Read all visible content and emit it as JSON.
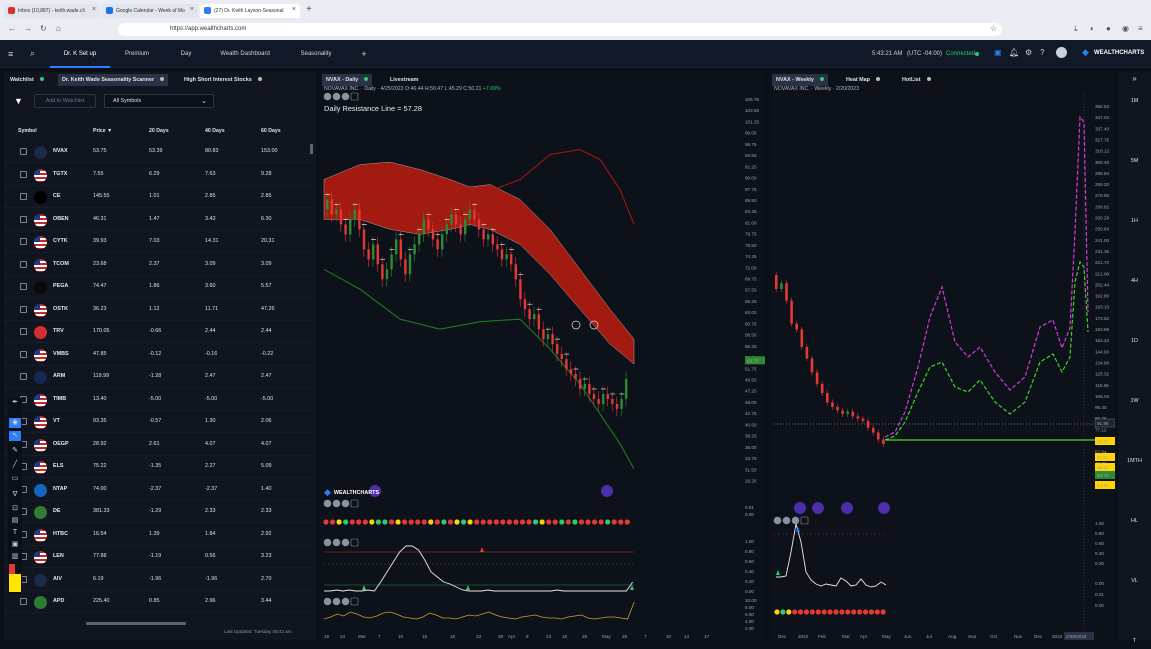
{
  "browser": {
    "tabs": [
      "Inbox (10,887) - keith.wade.cli",
      "Google Calendar - Week of Mo",
      "(27) Dr. Keith Layson-Seasonal"
    ],
    "url": "https://app.wealthcharts.com"
  },
  "app": {
    "tabs": [
      "Dr. K Set up",
      "Premium",
      "Day",
      "Wealth Dashboard",
      "Seasonality",
      "+"
    ],
    "time": "5:43:21 AM",
    "timezone": "(UTC -04:00)",
    "connection": "Connected",
    "brand": "WEALTHCHARTS"
  },
  "left": {
    "tabs": [
      "Watchlist",
      "Dr. Keith Wade Seasonality Scanner",
      "High Short Interest Stocks"
    ],
    "add_button": "Add to Watchlist",
    "filter_select": "All Symbols",
    "columns": [
      "Symbol",
      "Price",
      "20 Days",
      "40 Days",
      "60 Days"
    ],
    "rows": [
      {
        "sym": "NVAX",
        "price": "53.75",
        "d20": "53.39",
        "d40": "80.83",
        "d60": "153.00"
      },
      {
        "sym": "TGTX",
        "price": "7.55",
        "d20": "6.29",
        "d40": "7.63",
        "d60": "9.28"
      },
      {
        "sym": "CE",
        "price": "145.55",
        "d20": "1.01",
        "d40": "2.85",
        "d60": "2.85"
      },
      {
        "sym": "OBEN",
        "price": "46.31",
        "d20": "1.47",
        "d40": "3.43",
        "d60": "6.30"
      },
      {
        "sym": "CYTK",
        "price": "39.93",
        "d20": "7.03",
        "d40": "14.31",
        "d60": "20.31"
      },
      {
        "sym": "TCOM",
        "price": "23.68",
        "d20": "2.37",
        "d40": "3.09",
        "d60": "3.09"
      },
      {
        "sym": "PEGA",
        "price": "74.47",
        "d20": "1.86",
        "d40": "3.60",
        "d60": "5.57"
      },
      {
        "sym": "OSTK",
        "price": "36.23",
        "d20": "1.12",
        "d40": "11.71",
        "d60": "47.26"
      },
      {
        "sym": "TRV",
        "price": "170.05",
        "d20": "-0.66",
        "d40": "2.44",
        "d60": "2.44"
      },
      {
        "sym": "VMBS",
        "price": "47.85",
        "d20": "-0.12",
        "d40": "-0.16",
        "d60": "-0.22"
      },
      {
        "sym": "ARM",
        "price": "119.99",
        "d20": "-1.28",
        "d40": "2.47",
        "d60": "2.47"
      },
      {
        "sym": "TIMB",
        "price": "13.40",
        "d20": "-5.00",
        "d40": "-5.00",
        "d60": "-5.00"
      },
      {
        "sym": "VT",
        "price": "93.35",
        "d20": "-0.57",
        "d40": "1.30",
        "d60": "2.06"
      },
      {
        "sym": "OEGP",
        "price": "28.92",
        "d20": "2.61",
        "d40": "4.07",
        "d60": "4.07"
      },
      {
        "sym": "ELS",
        "price": "75.22",
        "d20": "-1.35",
        "d40": "2.27",
        "d60": "5.09"
      },
      {
        "sym": "NTAP",
        "price": "74.00",
        "d20": "-2.37",
        "d40": "-2.37",
        "d60": "1.40"
      },
      {
        "sym": "DE",
        "price": "381.33",
        "d20": "-1.29",
        "d40": "2.33",
        "d60": "2.33"
      },
      {
        "sym": "HTBC",
        "price": "16.54",
        "d20": "1.39",
        "d40": "1.84",
        "d60": "2.92"
      },
      {
        "sym": "LEN",
        "price": "77.88",
        "d20": "-1.19",
        "d40": "0.56",
        "d60": "3.23"
      },
      {
        "sym": "AIV",
        "price": "6.19",
        "d20": "-1.96",
        "d40": "-1.96",
        "d60": "2.70"
      },
      {
        "sym": "APD",
        "price": "225.40",
        "d20": "0.85",
        "d40": "2.96",
        "d60": "3.44"
      }
    ],
    "last_updated": "Last Updated: Tuesday 05:42 am"
  },
  "mid": {
    "tabs": [
      "NVAX - Daily",
      "Livestream"
    ],
    "symbol_line": "NOVAVAX INC. · Daily · 4/25/2022 O:46.44 H:50.47 L:45.29 C:50.21",
    "change": "+7.69%",
    "resistance": "Daily Resistance Line = 57.28",
    "brand": "WEALTHCHARTS",
    "price_axis": [
      "105.75",
      "103.50",
      "101.25",
      "99.00",
      "96.75",
      "94.50",
      "92.25",
      "90.00",
      "87.75",
      "85.50",
      "83.25",
      "81.00",
      "78.75",
      "76.50",
      "74.25",
      "72.00",
      "69.75",
      "67.50",
      "65.25",
      "63.00",
      "60.75",
      "58.50",
      "56.25",
      "54.00",
      "51.75",
      "49.50",
      "47.25",
      "45.00",
      "42.75",
      "40.50",
      "38.25",
      "36.00",
      "33.75",
      "31.50",
      "29.25"
    ],
    "last_price": "53.75",
    "date_axis": [
      "19",
      "24",
      "Mar",
      "7",
      "10",
      "15",
      "18",
      "23",
      "28",
      "Apr",
      "8",
      "13",
      "18",
      "25",
      "May",
      "25",
      "7",
      "10",
      "14",
      "17"
    ],
    "ind_axes": [
      [
        "0.01",
        "0.00"
      ],
      [
        "1.00",
        "0.80",
        "0.60",
        "0.40",
        "0.20",
        "0.00"
      ],
      [
        "10.00",
        "8.00",
        "6.00",
        "4.00",
        "2.00"
      ]
    ]
  },
  "right": {
    "tabs": [
      "NVAX - Weekly",
      "Heat Map",
      "HotList"
    ],
    "symbol_line": "NOVAVAX INC. · Weekly · 2/20/2023",
    "price_axis": [
      "356.53",
      "347.04",
      "337.40",
      "327.75",
      "318.12",
      "308.48",
      "298.84",
      "289.20",
      "279.56",
      "269.92",
      "260.28",
      "250.64",
      "241.00",
      "231.36",
      "221.72",
      "212.08",
      "202.44",
      "192.80",
      "183.16",
      "173.52",
      "163.88",
      "154.24",
      "144.60",
      "134.96",
      "125.32",
      "115.68",
      "106.04",
      "96.40",
      "86.76",
      "77.12",
      "67.48",
      "57.84",
      "48.20",
      "38.56",
      "28.92"
    ],
    "date_axis": [
      "Dec",
      "2022",
      "Feb",
      "Mar",
      "Apr",
      "May",
      "Jun",
      "Jul",
      "Aug",
      "Sep",
      "Oct",
      "Nov",
      "Dec",
      "2023"
    ],
    "price_tags": [
      "91.98",
      "81.82",
      "67.91",
      "59.32",
      "53.75",
      "44.16"
    ],
    "date_tag": "2/20/2023",
    "ind_axes": [
      [
        "1.00",
        "0.80",
        "0.60",
        "0.40",
        "0.20"
      ],
      [
        "0.00",
        "0.01",
        "0.00"
      ]
    ]
  },
  "timeframes": [
    "1M",
    "5M",
    "1H",
    "4H",
    "1D",
    "1W",
    "1MTH",
    "HL",
    "VL",
    "T"
  ]
}
